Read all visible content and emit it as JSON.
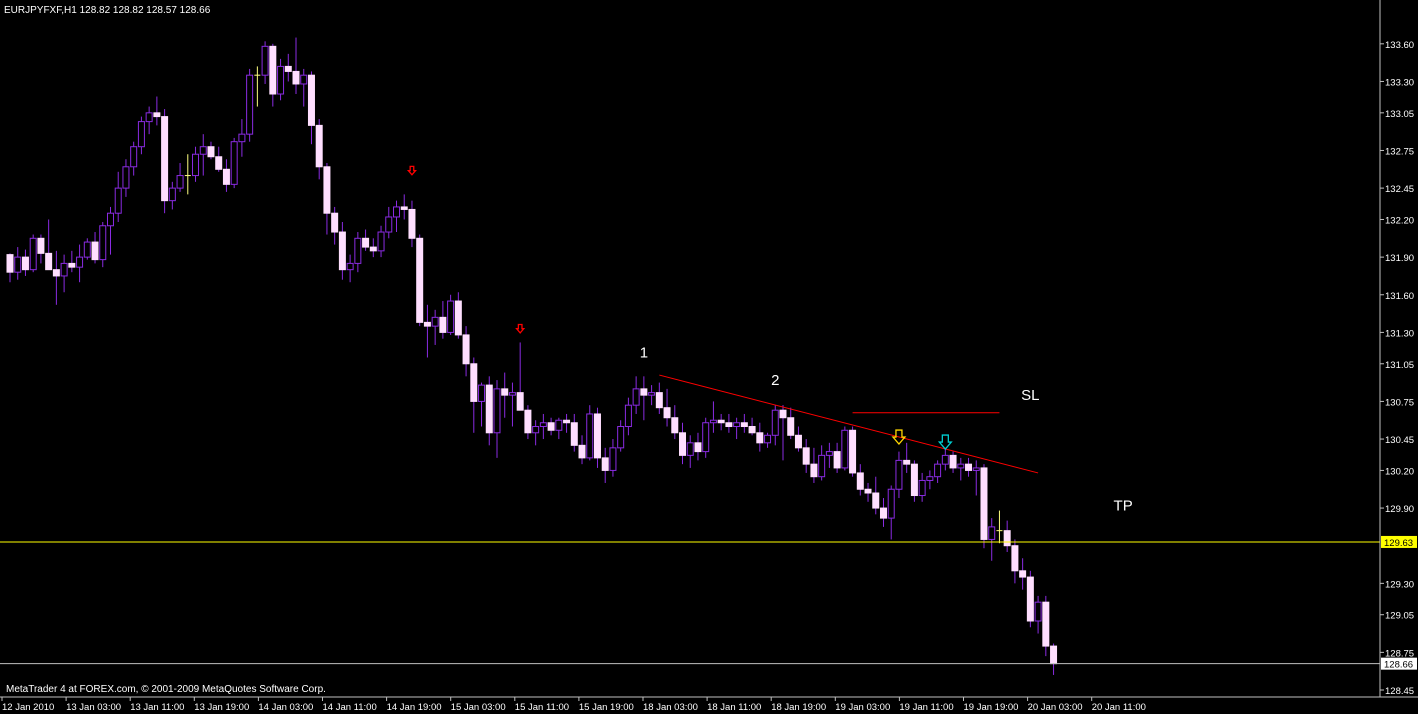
{
  "window": {
    "symbol_header": "EURJPYFXF,H1  128.82 128.82 128.57 128.66",
    "copyright": "MetaTrader 4 at FOREX.com, © 2001-2009 MetaQuotes Software Corp."
  },
  "colors": {
    "background": "#000000",
    "axis": "#c0c0c0",
    "bull_body": "#000000",
    "bear_body": "#ffdfff",
    "wick": "#8a2be2",
    "doji": "#ffff80",
    "trendline": "#ff0000",
    "tp_line": "#ffff00",
    "bid_line": "#c0c0c0",
    "arrow_sell": "#ff0000",
    "arrow_yellow": "#ffd700",
    "arrow_cyan": "#00ced1"
  },
  "chart_data": {
    "type": "candlestick",
    "ylim": [
      128.45,
      133.75
    ],
    "y_ticks": [
      "133.60",
      "133.30",
      "133.05",
      "132.75",
      "132.45",
      "132.20",
      "131.90",
      "131.60",
      "131.30",
      "131.05",
      "130.75",
      "130.45",
      "130.20",
      "129.90",
      "129.30",
      "129.05",
      "128.75",
      "128.45"
    ],
    "x_ticks": [
      "12 Jan 2010",
      "13 Jan 03:00",
      "13 Jan 11:00",
      "13 Jan 19:00",
      "14 Jan 03:00",
      "14 Jan 11:00",
      "14 Jan 19:00",
      "15 Jan 03:00",
      "15 Jan 11:00",
      "15 Jan 19:00",
      "18 Jan 03:00",
      "18 Jan 11:00",
      "18 Jan 19:00",
      "19 Jan 03:00",
      "19 Jan 11:00",
      "19 Jan 19:00",
      "20 Jan 03:00",
      "20 Jan 11:00"
    ],
    "tp_level": {
      "value": 129.63,
      "label": "129.63"
    },
    "bid_level": {
      "value": 128.66,
      "label": "128.66"
    },
    "annotations": [
      {
        "text": "1",
        "bar": 82,
        "price": 131.1
      },
      {
        "text": "2",
        "bar": 99,
        "price": 130.88
      },
      {
        "text": "SL",
        "bar": 132,
        "price": 130.76
      },
      {
        "text": "TP",
        "bar": 144,
        "price": 129.88
      }
    ],
    "trendline": {
      "from": {
        "bar": 84,
        "price": 130.96
      },
      "to": {
        "bar": 133,
        "price": 130.18
      }
    },
    "sl_line": {
      "from": {
        "bar": 109,
        "price": 130.66
      },
      "to": {
        "bar": 128,
        "price": 130.66
      }
    },
    "arrows": [
      {
        "bar": 52,
        "price": 132.58,
        "color": "arrow_sell"
      },
      {
        "bar": 66,
        "price": 131.32,
        "color": "arrow_sell"
      },
      {
        "bar": 115,
        "price": 130.45,
        "color": "arrow_yellow"
      },
      {
        "bar": 121,
        "price": 130.41,
        "color": "arrow_cyan"
      }
    ],
    "candles": [
      [
        131.92,
        131.93,
        131.7,
        131.78
      ],
      [
        131.78,
        131.98,
        131.72,
        131.9
      ],
      [
        131.9,
        131.96,
        131.75,
        131.8
      ],
      [
        131.8,
        132.08,
        131.78,
        132.05
      ],
      [
        132.05,
        132.08,
        131.85,
        131.93
      ],
      [
        131.93,
        132.2,
        131.88,
        131.8
      ],
      [
        131.8,
        131.95,
        131.52,
        131.75
      ],
      [
        131.75,
        131.92,
        131.62,
        131.85
      ],
      [
        131.85,
        131.95,
        131.78,
        131.82
      ],
      [
        131.82,
        132.0,
        131.7,
        131.9
      ],
      [
        131.9,
        132.05,
        131.88,
        132.02
      ],
      [
        132.02,
        132.1,
        131.85,
        131.88
      ],
      [
        131.88,
        132.18,
        131.82,
        132.15
      ],
      [
        132.15,
        132.3,
        131.92,
        132.25
      ],
      [
        132.25,
        132.58,
        132.18,
        132.45
      ],
      [
        132.45,
        132.68,
        132.38,
        132.62
      ],
      [
        132.62,
        132.82,
        132.55,
        132.78
      ],
      [
        132.78,
        133.02,
        132.72,
        132.98
      ],
      [
        132.98,
        133.1,
        132.88,
        133.05
      ],
      [
        133.05,
        133.18,
        132.95,
        133.02
      ],
      [
        133.02,
        133.08,
        132.25,
        132.35
      ],
      [
        132.35,
        132.5,
        132.28,
        132.45
      ],
      [
        132.45,
        132.65,
        132.42,
        132.55
      ],
      [
        132.55,
        132.72,
        132.4,
        132.55
      ],
      [
        132.55,
        132.78,
        132.5,
        132.72
      ],
      [
        132.72,
        132.88,
        132.55,
        132.78
      ],
      [
        132.78,
        132.82,
        132.68,
        132.7
      ],
      [
        132.7,
        132.78,
        132.58,
        132.6
      ],
      [
        132.6,
        132.68,
        132.42,
        132.48
      ],
      [
        132.48,
        132.85,
        132.45,
        132.82
      ],
      [
        132.82,
        133.0,
        132.7,
        132.88
      ],
      [
        132.88,
        133.4,
        132.82,
        133.35
      ],
      [
        133.35,
        133.42,
        133.1,
        133.35
      ],
      [
        133.35,
        133.62,
        133.28,
        133.58
      ],
      [
        133.58,
        133.6,
        133.1,
        133.2
      ],
      [
        133.2,
        133.48,
        133.15,
        133.42
      ],
      [
        133.42,
        133.52,
        133.3,
        133.38
      ],
      [
        133.38,
        133.65,
        133.2,
        133.28
      ],
      [
        133.28,
        133.4,
        133.1,
        133.35
      ],
      [
        133.35,
        133.38,
        132.8,
        132.95
      ],
      [
        132.95,
        133.0,
        132.52,
        132.62
      ],
      [
        132.62,
        132.65,
        132.08,
        132.25
      ],
      [
        132.25,
        132.3,
        132.0,
        132.1
      ],
      [
        132.1,
        132.18,
        131.72,
        131.8
      ],
      [
        131.8,
        131.92,
        131.7,
        131.85
      ],
      [
        131.85,
        132.1,
        131.78,
        132.05
      ],
      [
        132.05,
        132.12,
        131.95,
        131.98
      ],
      [
        131.98,
        132.05,
        131.9,
        131.95
      ],
      [
        131.95,
        132.15,
        131.9,
        132.1
      ],
      [
        132.1,
        132.3,
        132.05,
        132.22
      ],
      [
        132.22,
        132.35,
        132.1,
        132.3
      ],
      [
        132.3,
        132.4,
        132.2,
        132.28
      ],
      [
        132.28,
        132.35,
        131.98,
        132.05
      ],
      [
        132.05,
        132.08,
        131.35,
        131.38
      ],
      [
        131.38,
        131.52,
        131.1,
        131.35
      ],
      [
        131.35,
        131.48,
        131.2,
        131.42
      ],
      [
        131.42,
        131.55,
        131.25,
        131.3
      ],
      [
        131.3,
        131.6,
        131.28,
        131.55
      ],
      [
        131.55,
        131.62,
        131.25,
        131.28
      ],
      [
        131.28,
        131.35,
        130.95,
        131.05
      ],
      [
        131.05,
        131.1,
        130.5,
        130.75
      ],
      [
        130.75,
        130.9,
        130.55,
        130.88
      ],
      [
        130.88,
        130.95,
        130.4,
        130.5
      ],
      [
        130.5,
        130.92,
        130.3,
        130.85
      ],
      [
        130.85,
        130.98,
        130.62,
        130.8
      ],
      [
        130.8,
        130.9,
        130.55,
        130.82
      ],
      [
        130.82,
        131.22,
        130.7,
        130.68
      ],
      [
        130.68,
        130.72,
        130.45,
        130.5
      ],
      [
        130.5,
        130.6,
        130.4,
        130.55
      ],
      [
        130.55,
        130.65,
        130.45,
        130.58
      ],
      [
        130.58,
        130.62,
        130.48,
        130.52
      ],
      [
        130.52,
        130.62,
        130.45,
        130.6
      ],
      [
        130.6,
        130.65,
        130.5,
        130.58
      ],
      [
        130.58,
        130.65,
        130.35,
        130.4
      ],
      [
        130.4,
        130.48,
        130.25,
        130.3
      ],
      [
        130.3,
        130.72,
        130.28,
        130.65
      ],
      [
        130.65,
        130.7,
        130.22,
        130.3
      ],
      [
        130.3,
        130.38,
        130.1,
        130.2
      ],
      [
        130.2,
        130.45,
        130.15,
        130.38
      ],
      [
        130.38,
        130.6,
        130.35,
        130.55
      ],
      [
        130.55,
        130.78,
        130.48,
        130.72
      ],
      [
        130.72,
        130.95,
        130.65,
        130.85
      ],
      [
        130.85,
        130.95,
        130.6,
        130.8
      ],
      [
        130.8,
        130.88,
        130.72,
        130.82
      ],
      [
        130.82,
        130.9,
        130.65,
        130.7
      ],
      [
        130.7,
        130.85,
        130.55,
        130.62
      ],
      [
        130.62,
        130.72,
        130.45,
        130.5
      ],
      [
        130.5,
        130.58,
        130.25,
        130.32
      ],
      [
        130.32,
        130.48,
        130.22,
        130.42
      ],
      [
        130.42,
        130.5,
        130.28,
        130.35
      ],
      [
        130.35,
        130.62,
        130.3,
        130.58
      ],
      [
        130.58,
        130.75,
        130.5,
        130.6
      ],
      [
        130.6,
        130.65,
        130.52,
        130.58
      ],
      [
        130.58,
        130.65,
        130.5,
        130.55
      ],
      [
        130.55,
        130.62,
        130.45,
        130.58
      ],
      [
        130.58,
        130.65,
        130.5,
        130.55
      ],
      [
        130.55,
        130.62,
        130.48,
        130.5
      ],
      [
        130.5,
        130.58,
        130.35,
        130.42
      ],
      [
        130.42,
        130.5,
        130.38,
        130.48
      ],
      [
        130.48,
        130.72,
        130.4,
        130.68
      ],
      [
        130.68,
        130.72,
        130.28,
        130.62
      ],
      [
        130.62,
        130.7,
        130.45,
        130.48
      ],
      [
        130.48,
        130.55,
        130.35,
        130.38
      ],
      [
        130.38,
        130.45,
        130.18,
        130.25
      ],
      [
        130.25,
        130.38,
        130.1,
        130.15
      ],
      [
        130.15,
        130.4,
        130.12,
        130.32
      ],
      [
        130.32,
        130.42,
        130.22,
        130.35
      ],
      [
        130.35,
        130.42,
        130.18,
        130.22
      ],
      [
        130.22,
        130.55,
        130.2,
        130.52
      ],
      [
        130.52,
        130.55,
        130.15,
        130.18
      ],
      [
        130.18,
        130.25,
        130.0,
        130.05
      ],
      [
        130.05,
        130.1,
        129.95,
        130.02
      ],
      [
        130.02,
        130.15,
        129.85,
        129.9
      ],
      [
        129.9,
        129.98,
        129.75,
        129.82
      ],
      [
        129.82,
        130.08,
        129.65,
        130.05
      ],
      [
        130.05,
        130.35,
        129.98,
        130.28
      ],
      [
        130.28,
        130.42,
        130.18,
        130.25
      ],
      [
        130.25,
        130.28,
        129.95,
        130.0
      ],
      [
        130.0,
        130.18,
        129.95,
        130.12
      ],
      [
        130.12,
        130.2,
        130.05,
        130.15
      ],
      [
        130.15,
        130.28,
        130.1,
        130.25
      ],
      [
        130.25,
        130.38,
        130.2,
        130.32
      ],
      [
        130.32,
        130.35,
        130.18,
        130.22
      ],
      [
        130.22,
        130.3,
        130.12,
        130.25
      ],
      [
        130.25,
        130.3,
        130.15,
        130.2
      ],
      [
        130.2,
        130.28,
        130.0,
        130.22
      ],
      [
        130.22,
        130.25,
        129.58,
        129.65
      ],
      [
        129.65,
        129.82,
        129.48,
        129.75
      ],
      [
        129.72,
        129.88,
        129.62,
        129.72
      ],
      [
        129.72,
        129.8,
        129.55,
        129.6
      ],
      [
        129.6,
        129.65,
        129.3,
        129.4
      ],
      [
        129.4,
        129.5,
        129.25,
        129.35
      ],
      [
        129.35,
        129.4,
        128.95,
        129.0
      ],
      [
        129.0,
        129.2,
        128.9,
        129.15
      ],
      [
        129.15,
        129.2,
        128.72,
        128.8
      ],
      [
        128.8,
        128.82,
        128.57,
        128.66
      ]
    ]
  }
}
